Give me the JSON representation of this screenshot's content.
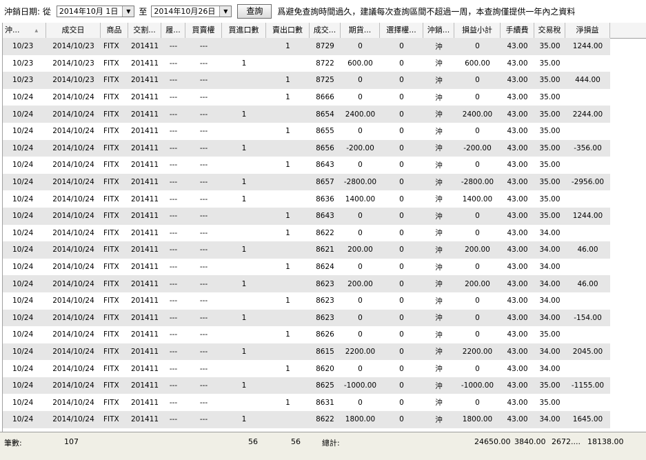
{
  "toolbar": {
    "date_label": "沖銷日期: 從",
    "from_date": "2014年10月 1日",
    "to_sep": "至",
    "to_date": "2014年10月26日",
    "query_button": "查詢",
    "notice": "爲避免查詢時間過久，建議每次查詢區間不超過一周，本查詢僅提供一年內之資料"
  },
  "columns": [
    {
      "key": "offset",
      "label": "沖...",
      "sort": "▲"
    },
    {
      "key": "trade_date",
      "label": "成交日"
    },
    {
      "key": "product",
      "label": "商品"
    },
    {
      "key": "month",
      "label": "交割..."
    },
    {
      "key": "strike",
      "label": "履..."
    },
    {
      "key": "cp",
      "label": "買賣權"
    },
    {
      "key": "buy_qty",
      "label": "買進口數"
    },
    {
      "key": "sell_qty",
      "label": "賣出口數"
    },
    {
      "key": "price",
      "label": "成交..."
    },
    {
      "key": "fut_pl",
      "label": "期貨..."
    },
    {
      "key": "opt_pl",
      "label": "選擇權..."
    },
    {
      "key": "flag",
      "label": "沖銷..."
    },
    {
      "key": "subtotal",
      "label": "損益小計"
    },
    {
      "key": "fee",
      "label": "手續費"
    },
    {
      "key": "tax",
      "label": "交易稅"
    },
    {
      "key": "net",
      "label": "淨損益"
    }
  ],
  "rows": [
    [
      "10/23",
      "2014/10/23",
      "FITX",
      "201411",
      "---",
      "---",
      "",
      "1",
      "8729",
      "0",
      "0",
      "沖",
      "0",
      "43.00",
      "35.00",
      "1244.00"
    ],
    [
      "10/23",
      "2014/10/23",
      "FITX",
      "201411",
      "---",
      "---",
      "1",
      "",
      "8722",
      "600.00",
      "0",
      "沖",
      "600.00",
      "43.00",
      "35.00",
      ""
    ],
    [
      "10/23",
      "2014/10/23",
      "FITX",
      "201411",
      "---",
      "---",
      "",
      "1",
      "8725",
      "0",
      "0",
      "沖",
      "0",
      "43.00",
      "35.00",
      "444.00"
    ],
    [
      "10/24",
      "2014/10/24",
      "FITX",
      "201411",
      "---",
      "---",
      "",
      "1",
      "8666",
      "0",
      "0",
      "沖",
      "0",
      "43.00",
      "35.00",
      ""
    ],
    [
      "10/24",
      "2014/10/24",
      "FITX",
      "201411",
      "---",
      "---",
      "1",
      "",
      "8654",
      "2400.00",
      "0",
      "沖",
      "2400.00",
      "43.00",
      "35.00",
      "2244.00"
    ],
    [
      "10/24",
      "2014/10/24",
      "FITX",
      "201411",
      "---",
      "---",
      "",
      "1",
      "8655",
      "0",
      "0",
      "沖",
      "0",
      "43.00",
      "35.00",
      ""
    ],
    [
      "10/24",
      "2014/10/24",
      "FITX",
      "201411",
      "---",
      "---",
      "1",
      "",
      "8656",
      "-200.00",
      "0",
      "沖",
      "-200.00",
      "43.00",
      "35.00",
      "-356.00"
    ],
    [
      "10/24",
      "2014/10/24",
      "FITX",
      "201411",
      "---",
      "---",
      "",
      "1",
      "8643",
      "0",
      "0",
      "沖",
      "0",
      "43.00",
      "35.00",
      ""
    ],
    [
      "10/24",
      "2014/10/24",
      "FITX",
      "201411",
      "---",
      "---",
      "1",
      "",
      "8657",
      "-2800.00",
      "0",
      "沖",
      "-2800.00",
      "43.00",
      "35.00",
      "-2956.00"
    ],
    [
      "10/24",
      "2014/10/24",
      "FITX",
      "201411",
      "---",
      "---",
      "1",
      "",
      "8636",
      "1400.00",
      "0",
      "沖",
      "1400.00",
      "43.00",
      "35.00",
      ""
    ],
    [
      "10/24",
      "2014/10/24",
      "FITX",
      "201411",
      "---",
      "---",
      "",
      "1",
      "8643",
      "0",
      "0",
      "沖",
      "0",
      "43.00",
      "35.00",
      "1244.00"
    ],
    [
      "10/24",
      "2014/10/24",
      "FITX",
      "201411",
      "---",
      "---",
      "",
      "1",
      "8622",
      "0",
      "0",
      "沖",
      "0",
      "43.00",
      "34.00",
      ""
    ],
    [
      "10/24",
      "2014/10/24",
      "FITX",
      "201411",
      "---",
      "---",
      "1",
      "",
      "8621",
      "200.00",
      "0",
      "沖",
      "200.00",
      "43.00",
      "34.00",
      "46.00"
    ],
    [
      "10/24",
      "2014/10/24",
      "FITX",
      "201411",
      "---",
      "---",
      "",
      "1",
      "8624",
      "0",
      "0",
      "沖",
      "0",
      "43.00",
      "34.00",
      ""
    ],
    [
      "10/24",
      "2014/10/24",
      "FITX",
      "201411",
      "---",
      "---",
      "1",
      "",
      "8623",
      "200.00",
      "0",
      "沖",
      "200.00",
      "43.00",
      "34.00",
      "46.00"
    ],
    [
      "10/24",
      "2014/10/24",
      "FITX",
      "201411",
      "---",
      "---",
      "",
      "1",
      "8623",
      "0",
      "0",
      "沖",
      "0",
      "43.00",
      "34.00",
      ""
    ],
    [
      "10/24",
      "2014/10/24",
      "FITX",
      "201411",
      "---",
      "---",
      "1",
      "",
      "8623",
      "0",
      "0",
      "沖",
      "0",
      "43.00",
      "34.00",
      "-154.00"
    ],
    [
      "10/24",
      "2014/10/24",
      "FITX",
      "201411",
      "---",
      "---",
      "",
      "1",
      "8626",
      "0",
      "0",
      "沖",
      "0",
      "43.00",
      "35.00",
      ""
    ],
    [
      "10/24",
      "2014/10/24",
      "FITX",
      "201411",
      "---",
      "---",
      "1",
      "",
      "8615",
      "2200.00",
      "0",
      "沖",
      "2200.00",
      "43.00",
      "34.00",
      "2045.00"
    ],
    [
      "10/24",
      "2014/10/24",
      "FITX",
      "201411",
      "---",
      "---",
      "",
      "1",
      "8620",
      "0",
      "0",
      "沖",
      "0",
      "43.00",
      "34.00",
      ""
    ],
    [
      "10/24",
      "2014/10/24",
      "FITX",
      "201411",
      "---",
      "---",
      "1",
      "",
      "8625",
      "-1000.00",
      "0",
      "沖",
      "-1000.00",
      "43.00",
      "35.00",
      "-1155.00"
    ],
    [
      "10/24",
      "2014/10/24",
      "FITX",
      "201411",
      "---",
      "---",
      "",
      "1",
      "8631",
      "0",
      "0",
      "沖",
      "0",
      "43.00",
      "35.00",
      ""
    ],
    [
      "10/24",
      "2014/10/24",
      "FITX",
      "201411",
      "---",
      "---",
      "1",
      "",
      "8622",
      "1800.00",
      "0",
      "沖",
      "1800.00",
      "43.00",
      "34.00",
      "1645.00"
    ]
  ],
  "footer": {
    "count_label": "筆數:",
    "count": "107",
    "buy_total": "56",
    "sell_total": "56",
    "total_label": "總計:",
    "subtotal": "24650.00",
    "fee": "3840.00",
    "tax": "2672....",
    "net": "18138.00"
  }
}
